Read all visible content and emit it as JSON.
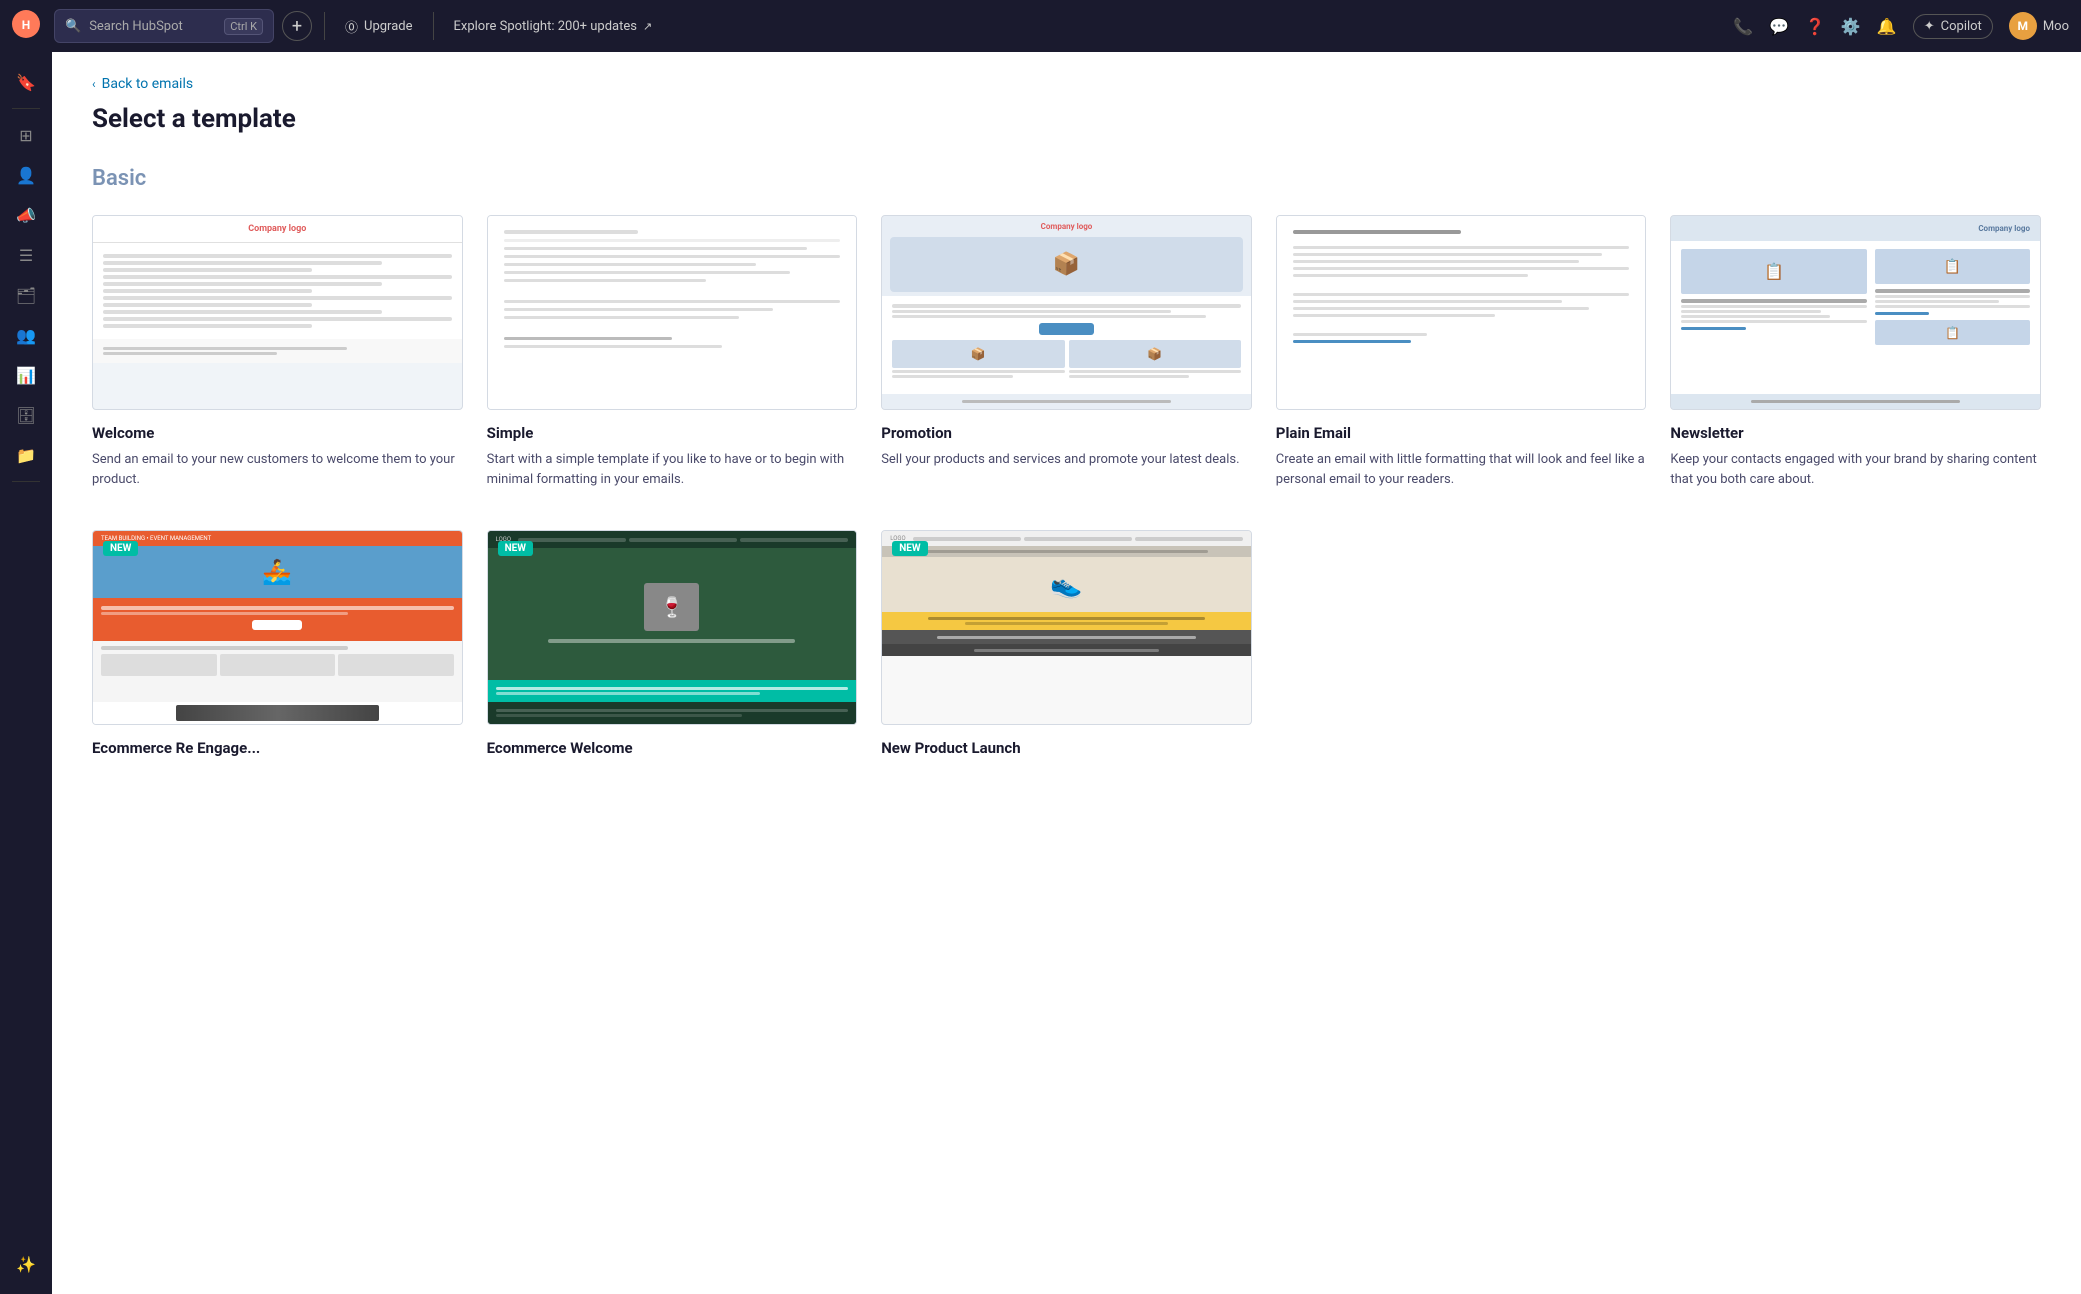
{
  "topnav": {
    "search_placeholder": "Search HubSpot",
    "search_shortcut": "Ctrl K",
    "plus_label": "+",
    "upgrade_label": "Upgrade",
    "spotlight_label": "Explore Spotlight: 200+ updates",
    "copilot_label": "Copilot",
    "user_initials": "M",
    "username": "Moo"
  },
  "sidebar": {
    "items": [
      {
        "name": "bookmark-icon",
        "icon": "🔖"
      },
      {
        "name": "minus-icon",
        "icon": "—"
      },
      {
        "name": "grid-icon",
        "icon": "⊞"
      },
      {
        "name": "contacts-icon",
        "icon": "👤"
      },
      {
        "name": "megaphone-icon",
        "icon": "📣"
      },
      {
        "name": "list-icon",
        "icon": "☰"
      },
      {
        "name": "folder-alt-icon",
        "icon": "🗂"
      },
      {
        "name": "users-icon",
        "icon": "👥"
      },
      {
        "name": "bar-chart-icon",
        "icon": "📊"
      },
      {
        "name": "database-icon",
        "icon": "🗄"
      },
      {
        "name": "folder-icon",
        "icon": "📁"
      },
      {
        "name": "sparkle-icon",
        "icon": "✨"
      }
    ]
  },
  "page": {
    "back_label": "Back to emails",
    "title": "Select a template",
    "section_basic": "Basic"
  },
  "templates_row1": [
    {
      "id": "welcome",
      "name": "Welcome",
      "description": "Send an email to your new customers to welcome them to your product.",
      "type": "welcome",
      "is_new": false
    },
    {
      "id": "simple",
      "name": "Simple",
      "description": "Start with a simple template if you like to have or to begin with minimal formatting in your emails.",
      "type": "simple",
      "is_new": false
    },
    {
      "id": "promotion",
      "name": "Promotion",
      "description": "Sell your products and services and promote your latest deals.",
      "type": "promotion",
      "is_new": false
    },
    {
      "id": "plain-email",
      "name": "Plain Email",
      "description": "Create an email with little formatting that will look and feel like a personal email to your readers.",
      "type": "plain",
      "is_new": false
    },
    {
      "id": "newsletter",
      "name": "Newsletter",
      "description": "Keep your contacts engaged with your brand by sharing content that you both care about.",
      "type": "newsletter",
      "is_new": false
    }
  ],
  "templates_row2": [
    {
      "id": "ecommerce-reengage",
      "name": "Ecommerce Re Engage...",
      "type": "ecomm-reengage",
      "is_new": true
    },
    {
      "id": "ecommerce-welcome",
      "name": "Ecommerce Welcome",
      "type": "ecomm-welcome",
      "is_new": true
    },
    {
      "id": "new-product-launch",
      "name": "New Product Launch",
      "type": "new-product",
      "is_new": true
    }
  ]
}
